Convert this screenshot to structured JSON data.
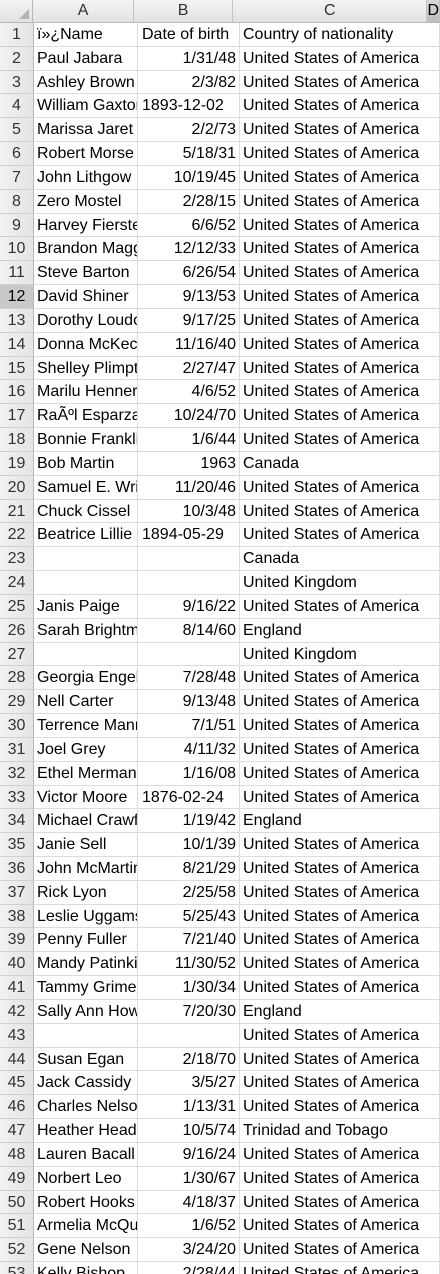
{
  "sheet": {
    "columns": [
      "A",
      "B",
      "C",
      "D"
    ],
    "selected_column": "D",
    "selected_row": "12",
    "rows": [
      {
        "n": "1",
        "a": "ï»¿Name",
        "b": "Date of birth",
        "c": "Country of nationality"
      },
      {
        "n": "2",
        "a": "Paul Jabara",
        "b": "1/31/48",
        "c": "United States of America"
      },
      {
        "n": "3",
        "a": "Ashley Brown",
        "b": "2/3/82",
        "c": "United States of America"
      },
      {
        "n": "4",
        "a": "William Gaxton",
        "b": "1893-12-02",
        "c": "United States of America"
      },
      {
        "n": "5",
        "a": "Marissa Jaret",
        "b": "2/2/73",
        "c": "United States of America"
      },
      {
        "n": "6",
        "a": "Robert Morse",
        "b": "5/18/31",
        "c": "United States of America"
      },
      {
        "n": "7",
        "a": "John Lithgow",
        "b": "10/19/45",
        "c": "United States of America"
      },
      {
        "n": "8",
        "a": "Zero Mostel",
        "b": "2/28/15",
        "c": "United States of America"
      },
      {
        "n": "9",
        "a": "Harvey Fierstein",
        "b": "6/6/52",
        "c": "United States of America"
      },
      {
        "n": "10",
        "a": "Brandon Maggart",
        "b": "12/12/33",
        "c": "United States of America"
      },
      {
        "n": "11",
        "a": "Steve Barton",
        "b": "6/26/54",
        "c": "United States of America"
      },
      {
        "n": "12",
        "a": "David Shiner",
        "b": "9/13/53",
        "c": "United States of America"
      },
      {
        "n": "13",
        "a": "Dorothy Loudon",
        "b": "9/17/25",
        "c": "United States of America"
      },
      {
        "n": "14",
        "a": "Donna McKechnie",
        "b": "11/16/40",
        "c": "United States of America"
      },
      {
        "n": "15",
        "a": "Shelley Plimpton",
        "b": "2/27/47",
        "c": "United States of America"
      },
      {
        "n": "16",
        "a": "Marilu Henner",
        "b": "4/6/52",
        "c": "United States of America"
      },
      {
        "n": "17",
        "a": "RaÃºl Esparza",
        "b": "10/24/70",
        "c": "United States of America"
      },
      {
        "n": "18",
        "a": "Bonnie Franklin",
        "b": "1/6/44",
        "c": "United States of America"
      },
      {
        "n": "19",
        "a": "Bob Martin",
        "b": "1963",
        "c": "Canada"
      },
      {
        "n": "20",
        "a": "Samuel E. Wright",
        "b": "11/20/46",
        "c": "United States of America"
      },
      {
        "n": "21",
        "a": "Chuck Cissel",
        "b": "10/3/48",
        "c": "United States of America"
      },
      {
        "n": "22",
        "a": "Beatrice Lillie",
        "b": "1894-05-29",
        "c": "United States of America"
      },
      {
        "n": "23",
        "a": "",
        "b": "",
        "c": "Canada"
      },
      {
        "n": "24",
        "a": "",
        "b": "",
        "c": "United Kingdom"
      },
      {
        "n": "25",
        "a": "Janis Paige",
        "b": "9/16/22",
        "c": "United States of America"
      },
      {
        "n": "26",
        "a": "Sarah Brightman",
        "b": "8/14/60",
        "c": "England"
      },
      {
        "n": "27",
        "a": "",
        "b": "",
        "c": "United Kingdom"
      },
      {
        "n": "28",
        "a": "Georgia Engel",
        "b": "7/28/48",
        "c": "United States of America"
      },
      {
        "n": "29",
        "a": "Nell Carter",
        "b": "9/13/48",
        "c": "United States of America"
      },
      {
        "n": "30",
        "a": "Terrence Mann",
        "b": "7/1/51",
        "c": "United States of America"
      },
      {
        "n": "31",
        "a": "Joel Grey",
        "b": "4/11/32",
        "c": "United States of America"
      },
      {
        "n": "32",
        "a": "Ethel Merman",
        "b": "1/16/08",
        "c": "United States of America"
      },
      {
        "n": "33",
        "a": "Victor Moore",
        "b": "1876-02-24",
        "c": "United States of America"
      },
      {
        "n": "34",
        "a": "Michael Crawford",
        "b": "1/19/42",
        "c": "England"
      },
      {
        "n": "35",
        "a": "Janie Sell",
        "b": "10/1/39",
        "c": "United States of America"
      },
      {
        "n": "36",
        "a": "John McMartin",
        "b": "8/21/29",
        "c": "United States of America"
      },
      {
        "n": "37",
        "a": "Rick Lyon",
        "b": "2/25/58",
        "c": "United States of America"
      },
      {
        "n": "38",
        "a": "Leslie Uggams",
        "b": "5/25/43",
        "c": "United States of America"
      },
      {
        "n": "39",
        "a": "Penny Fuller",
        "b": "7/21/40",
        "c": "United States of America"
      },
      {
        "n": "40",
        "a": "Mandy Patinkin",
        "b": "11/30/52",
        "c": "United States of America"
      },
      {
        "n": "41",
        "a": "Tammy Grimes",
        "b": "1/30/34",
        "c": "United States of America"
      },
      {
        "n": "42",
        "a": "Sally Ann Howes",
        "b": "7/20/30",
        "c": "England"
      },
      {
        "n": "43",
        "a": "",
        "b": "",
        "c": "United States of America"
      },
      {
        "n": "44",
        "a": "Susan Egan",
        "b": "2/18/70",
        "c": "United States of America"
      },
      {
        "n": "45",
        "a": "Jack Cassidy",
        "b": "3/5/27",
        "c": "United States of America"
      },
      {
        "n": "46",
        "a": "Charles Nelson",
        "b": "1/13/31",
        "c": "United States of America"
      },
      {
        "n": "47",
        "a": "Heather Headley",
        "b": "10/5/74",
        "c": "Trinidad and Tobago"
      },
      {
        "n": "48",
        "a": "Lauren Bacall",
        "b": "9/16/24",
        "c": "United States of America"
      },
      {
        "n": "49",
        "a": "Norbert Leo",
        "b": "1/30/67",
        "c": "United States of America"
      },
      {
        "n": "50",
        "a": "Robert Hooks",
        "b": "4/18/37",
        "c": "United States of America"
      },
      {
        "n": "51",
        "a": "Armelia McQueen",
        "b": "1/6/52",
        "c": "United States of America"
      },
      {
        "n": "52",
        "a": "Gene Nelson",
        "b": "3/24/20",
        "c": "United States of America"
      },
      {
        "n": "53",
        "a": "Kelly Bishop",
        "b": "2/28/44",
        "c": "United States of America"
      }
    ]
  }
}
